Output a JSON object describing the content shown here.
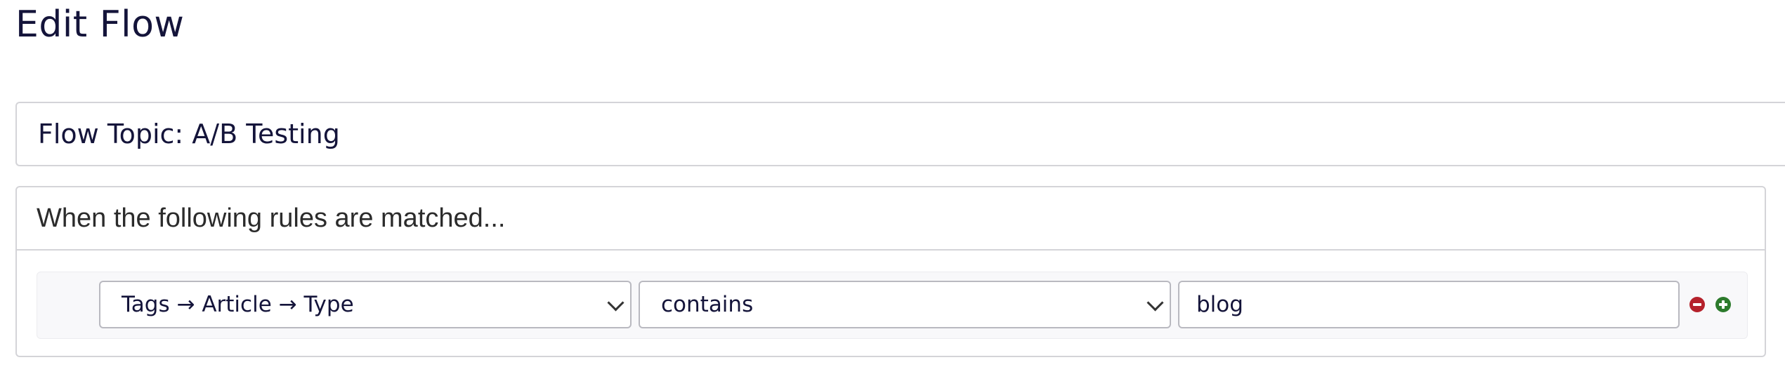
{
  "page": {
    "title": "Edit Flow"
  },
  "flow": {
    "topic_text": "Flow Topic: A/B Testing"
  },
  "rules": {
    "header": "When the following rules are matched...",
    "items": [
      {
        "field": "Tags → Article → Type",
        "operator": "contains",
        "value": "blog"
      }
    ]
  },
  "icons": {
    "remove": "minus-circle-icon",
    "add": "plus-circle-icon"
  },
  "colors": {
    "text": "#14143a",
    "border": "#d4d4d8",
    "remove": "#b5212b",
    "add": "#2c7a2c"
  }
}
